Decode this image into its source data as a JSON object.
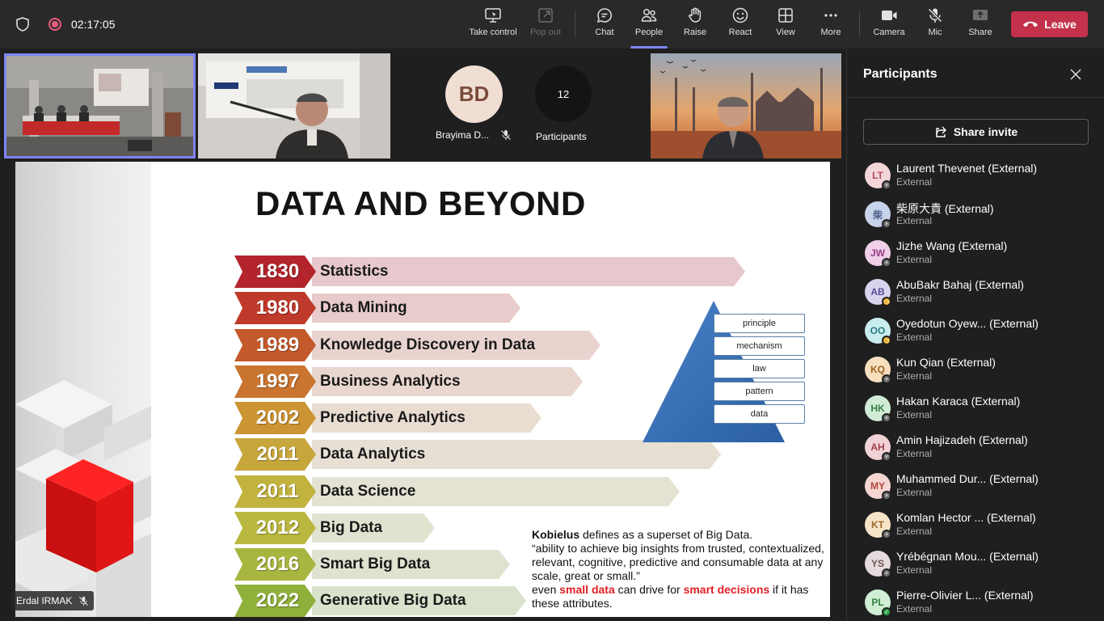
{
  "top_bar": {
    "timer": "02:17:05",
    "buttons": [
      {
        "label": "Take control",
        "icon": "screen-share-control-icon"
      },
      {
        "label": "Pop out",
        "icon": "pop-out-icon",
        "disabled": true
      },
      {
        "label": "Chat",
        "icon": "chat-icon"
      },
      {
        "label": "People",
        "icon": "people-icon",
        "active": true
      },
      {
        "label": "Raise",
        "icon": "raise-hand-icon"
      },
      {
        "label": "React",
        "icon": "react-smile-icon"
      },
      {
        "label": "View",
        "icon": "view-grid-icon"
      },
      {
        "label": "More",
        "icon": "more-dots-icon"
      },
      {
        "label": "Camera",
        "icon": "camera-icon"
      },
      {
        "label": "Mic",
        "icon": "mic-off-icon"
      },
      {
        "label": "Share",
        "icon": "share-tray-icon"
      }
    ],
    "leave_label": "Leave"
  },
  "gallery": {
    "avatar_initials": "BD",
    "avatar_name": "Brayima D...",
    "participant_count": "12",
    "participant_count_label": "Participants"
  },
  "slide": {
    "title": "DATA AND BEYOND",
    "timeline": [
      {
        "year": "1830",
        "label": "Statistics",
        "year_color": "#b3242d",
        "bar_color": "#e7c8cc"
      },
      {
        "year": "1980",
        "label": "Data Mining",
        "year_color": "#bf3a2b",
        "bar_color": "#e8cbcb"
      },
      {
        "year": "1989",
        "label": "Knowledge Discovery in Data",
        "year_color": "#c45a2c",
        "bar_color": "#e9d3cf"
      },
      {
        "year": "1997",
        "label": "Business Analytics",
        "year_color": "#c9742f",
        "bar_color": "#e9d7cf"
      },
      {
        "year": "2002",
        "label": "Predictive Analytics",
        "year_color": "#cc9433",
        "bar_color": "#e9dcd1"
      },
      {
        "year": "2011",
        "label": "Data Analytics",
        "year_color": "#c7a63b",
        "bar_color": "#e7dfd4"
      },
      {
        "year": "2011",
        "label": "Data Science",
        "year_color": "#c2b23e",
        "bar_color": "#e4e2d2"
      },
      {
        "year": "2012",
        "label": "Big Data",
        "year_color": "#b9b73f",
        "bar_color": "#e1e3d1"
      },
      {
        "year": "2016",
        "label": "Smart Big Data",
        "year_color": "#a8b53f",
        "bar_color": "#dde3cf"
      },
      {
        "year": "2022",
        "label": "Generative Big Data",
        "year_color": "#8fb03b",
        "bar_color": "#d9e2cd"
      }
    ],
    "pyramid_labels": [
      "principle",
      "mechanism",
      "law",
      "pattern",
      "data"
    ],
    "kobielus": {
      "name": "Kobielus",
      "intro": " defines as a superset of Big Data.",
      "quote": "“ability to achieve big insights from trusted, contextualized, relevant, cognitive, predictive and consumable data at any scale, great or small.”",
      "pre": "even ",
      "small": "small data",
      "mid": " can drive for ",
      "smart": "smart decisions",
      "post": " if it  has these attributes."
    },
    "presenter_name": "Erdal IRMAK"
  },
  "panel": {
    "title": "Participants",
    "share_label": "Share invite",
    "participants": [
      {
        "initials": "LT",
        "name": "Laurent Thevenet (External)",
        "sub": "External",
        "bg": "#f3d6d8",
        "fg": "#b24a5a",
        "status": "offline"
      },
      {
        "initials": "柴",
        "name": "柴原大貴 (External)",
        "sub": "External",
        "bg": "#c7d3ea",
        "fg": "#4a5d8a",
        "status": "offline"
      },
      {
        "initials": "JW",
        "name": "Jizhe Wang (External)",
        "sub": "External",
        "bg": "#efd0e8",
        "fg": "#9a3a86",
        "status": "offline"
      },
      {
        "initials": "AB",
        "name": "AbuBakr Bahaj (External)",
        "sub": "External",
        "bg": "#d9d4ee",
        "fg": "#5a4d9a",
        "status": "away"
      },
      {
        "initials": "OO",
        "name": "Oyedotun Oyew... (External)",
        "sub": "External",
        "bg": "#c9ecef",
        "fg": "#2c7c85",
        "status": "away"
      },
      {
        "initials": "KQ",
        "name": "Kun Qian (External)",
        "sub": "External",
        "bg": "#f7dfbf",
        "fg": "#9a6322",
        "status": "offline"
      },
      {
        "initials": "HK",
        "name": "Hakan Karaca (External)",
        "sub": "External",
        "bg": "#d1ecd6",
        "fg": "#3a7d48",
        "status": "offline"
      },
      {
        "initials": "AH",
        "name": "Amin Hajizadeh (External)",
        "sub": "External",
        "bg": "#f1d2d6",
        "fg": "#a2414f",
        "status": "offline"
      },
      {
        "initials": "MY",
        "name": "Muhammed Dur... (External)",
        "sub": "External",
        "bg": "#f5d6d3",
        "fg": "#b2453b",
        "status": "offline"
      },
      {
        "initials": "KT",
        "name": "Komlan Hector ...  (External)",
        "sub": "External",
        "bg": "#f7e3c8",
        "fg": "#9b6a2b",
        "status": "offline"
      },
      {
        "initials": "YS",
        "name": "Yrébégnan Mou... (External)",
        "sub": "External",
        "bg": "#e4dcdc",
        "fg": "#6e5454",
        "status": "offline"
      },
      {
        "initials": "PL",
        "name": "Pierre-Olivier L... (External)",
        "sub": "External",
        "bg": "#d0eed3",
        "fg": "#2f8440",
        "status": "available"
      }
    ]
  }
}
